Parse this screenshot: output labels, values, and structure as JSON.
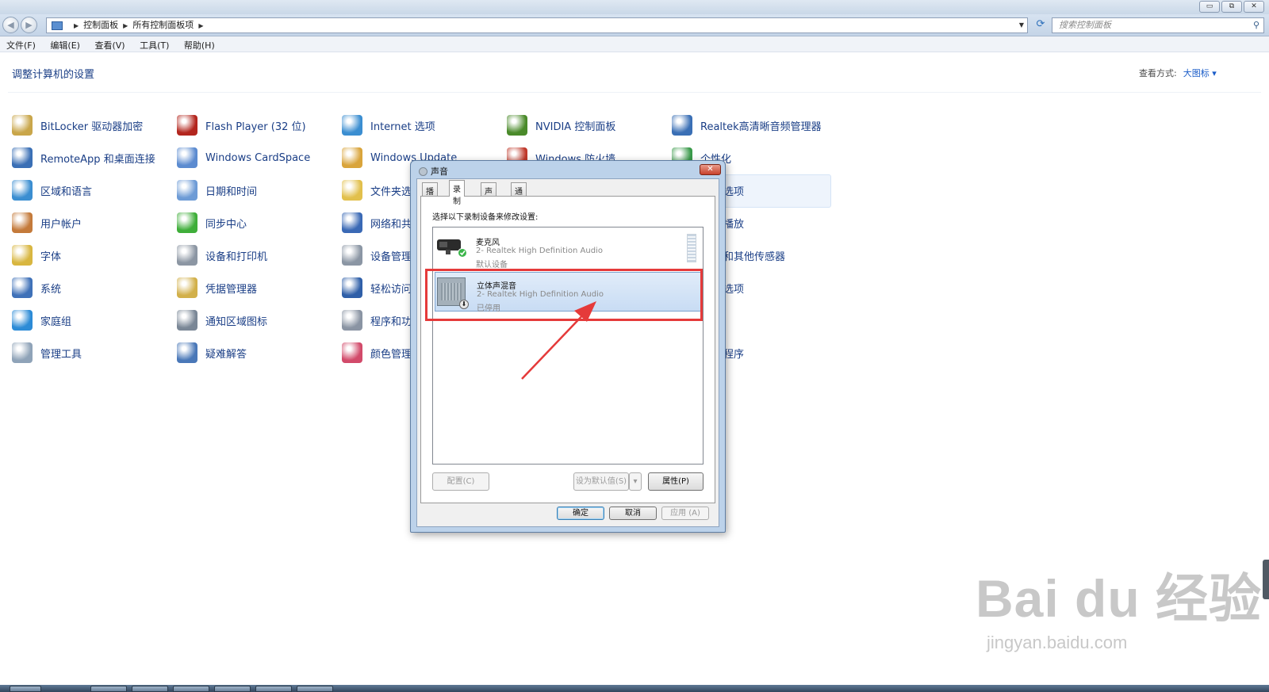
{
  "window": {
    "buttons": {
      "minimize": "▭",
      "restore": "⧉",
      "close": "✕"
    }
  },
  "address": {
    "breadcrumb": [
      "控制面板",
      "所有控制面板项"
    ],
    "search_placeholder": "搜索控制面板"
  },
  "menu": [
    "文件(F)",
    "编辑(E)",
    "查看(V)",
    "工具(T)",
    "帮助(H)"
  ],
  "control_panel": {
    "title": "调整计算机的设置",
    "view_by_label": "查看方式:",
    "view_by_value": "大图标 ▾",
    "items": [
      {
        "label": "BitLocker 驱动器加密",
        "icon": "bitlocker-icon",
        "color": "#c9a64a"
      },
      {
        "label": "RemoteApp 和桌面连接",
        "icon": "remoteapp-icon",
        "color": "#3a6fb5"
      },
      {
        "label": "区域和语言",
        "icon": "globe-icon",
        "color": "#3b8ed1"
      },
      {
        "label": "用户帐户",
        "icon": "users-icon",
        "color": "#c47a3a"
      },
      {
        "label": "字体",
        "icon": "fonts-icon",
        "color": "#d8b640"
      },
      {
        "label": "系统",
        "icon": "system-icon",
        "color": "#3f71b8"
      },
      {
        "label": "家庭组",
        "icon": "homegroup-icon",
        "color": "#2c8bd6"
      },
      {
        "label": "管理工具",
        "icon": "admin-tools-icon",
        "color": "#8fa3b8"
      },
      {
        "label": "Flash Player (32 位)",
        "icon": "flash-icon",
        "color": "#b3261e"
      },
      {
        "label": "Windows CardSpace",
        "icon": "cardspace-icon",
        "color": "#5b8bd0"
      },
      {
        "label": "日期和时间",
        "icon": "datetime-icon",
        "color": "#6d9bd6"
      },
      {
        "label": "同步中心",
        "icon": "sync-icon",
        "color": "#3fae3a"
      },
      {
        "label": "设备和打印机",
        "icon": "printer-icon",
        "color": "#8c96a3"
      },
      {
        "label": "凭据管理器",
        "icon": "credentials-icon",
        "color": "#d2b04a"
      },
      {
        "label": "通知区域图标",
        "icon": "notification-icon",
        "color": "#7a8796"
      },
      {
        "label": "疑难解答",
        "icon": "troubleshoot-icon",
        "color": "#4a78b8"
      },
      {
        "label": "Internet 选项",
        "icon": "internet-icon",
        "color": "#3b8ed1"
      },
      {
        "label": "Windows Update",
        "icon": "windows-update-icon",
        "color": "#d9a43b"
      },
      {
        "label": "文件夹选",
        "icon": "folder-icon",
        "color": "#e2c04c"
      },
      {
        "label": "网络和共",
        "icon": "network-icon",
        "color": "#3a69b5"
      },
      {
        "label": "设备管理",
        "icon": "device-manager-icon",
        "color": "#8b96a4"
      },
      {
        "label": "轻松访问",
        "icon": "ease-access-icon",
        "color": "#2f5fa8"
      },
      {
        "label": "程序和功",
        "icon": "programs-icon",
        "color": "#8a94a3"
      },
      {
        "label": "颜色管理",
        "icon": "color-icon",
        "color": "#d24a6a"
      },
      {
        "label": "NVIDIA 控制面板",
        "icon": "nvidia-icon",
        "color": "#4a8a2a"
      },
      {
        "label": "Windows 防火墙",
        "icon": "firewall-icon",
        "color": "#c0392b"
      },
      {
        "label": "Realtek高清晰音频管理器",
        "icon": "realtek-icon",
        "color": "#3a6fb5"
      },
      {
        "label": "个性化",
        "icon": "personalize-icon",
        "color": "#3a9a4a"
      },
      {
        "label": "选项",
        "icon": "",
        "color": ""
      },
      {
        "label": "播放",
        "icon": "",
        "color": ""
      },
      {
        "label": "和其他传感器",
        "icon": "",
        "color": ""
      },
      {
        "label": "选项",
        "icon": "",
        "color": ""
      },
      {
        "label": "程序",
        "icon": "",
        "color": ""
      }
    ]
  },
  "sound_dialog": {
    "title": "声音",
    "close": "✕",
    "tabs": [
      "播放",
      "录制",
      "声音",
      "通信"
    ],
    "active_tab": "录制",
    "instruction": "选择以下录制设备来修改设置:",
    "devices": [
      {
        "name": "麦克风",
        "driver": "2- Realtek High Definition Audio",
        "status": "默认设备"
      },
      {
        "name": "立体声混音",
        "driver": "2- Realtek High Definition Audio",
        "status": "已停用"
      }
    ],
    "buttons": {
      "configure": "配置(C)",
      "set_default": "设为默认值(S)",
      "properties": "属性(P)",
      "ok": "确定",
      "cancel": "取消",
      "apply": "应用 (A)"
    }
  },
  "watermark": {
    "logo": "Bai du 经验",
    "url": "jingyan.baidu.com"
  },
  "colors": {
    "link": "#1a3e86",
    "annotation": "#e53a3a"
  }
}
